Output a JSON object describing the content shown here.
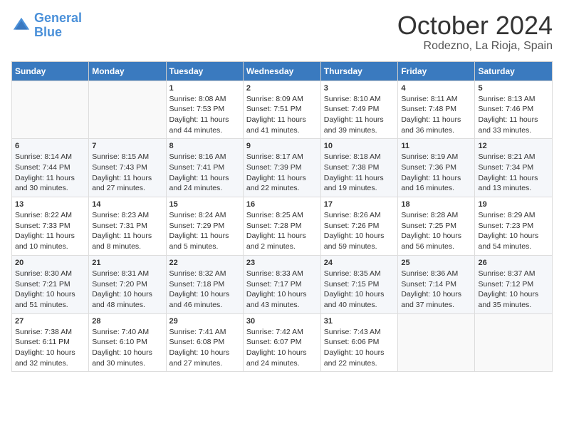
{
  "header": {
    "logo_line1": "General",
    "logo_line2": "Blue",
    "month": "October 2024",
    "location": "Rodezno, La Rioja, Spain"
  },
  "days_of_week": [
    "Sunday",
    "Monday",
    "Tuesday",
    "Wednesday",
    "Thursday",
    "Friday",
    "Saturday"
  ],
  "weeks": [
    [
      {
        "day": "",
        "content": ""
      },
      {
        "day": "",
        "content": ""
      },
      {
        "day": "1",
        "content": "Sunrise: 8:08 AM\nSunset: 7:53 PM\nDaylight: 11 hours and 44 minutes."
      },
      {
        "day": "2",
        "content": "Sunrise: 8:09 AM\nSunset: 7:51 PM\nDaylight: 11 hours and 41 minutes."
      },
      {
        "day": "3",
        "content": "Sunrise: 8:10 AM\nSunset: 7:49 PM\nDaylight: 11 hours and 39 minutes."
      },
      {
        "day": "4",
        "content": "Sunrise: 8:11 AM\nSunset: 7:48 PM\nDaylight: 11 hours and 36 minutes."
      },
      {
        "day": "5",
        "content": "Sunrise: 8:13 AM\nSunset: 7:46 PM\nDaylight: 11 hours and 33 minutes."
      }
    ],
    [
      {
        "day": "6",
        "content": "Sunrise: 8:14 AM\nSunset: 7:44 PM\nDaylight: 11 hours and 30 minutes."
      },
      {
        "day": "7",
        "content": "Sunrise: 8:15 AM\nSunset: 7:43 PM\nDaylight: 11 hours and 27 minutes."
      },
      {
        "day": "8",
        "content": "Sunrise: 8:16 AM\nSunset: 7:41 PM\nDaylight: 11 hours and 24 minutes."
      },
      {
        "day": "9",
        "content": "Sunrise: 8:17 AM\nSunset: 7:39 PM\nDaylight: 11 hours and 22 minutes."
      },
      {
        "day": "10",
        "content": "Sunrise: 8:18 AM\nSunset: 7:38 PM\nDaylight: 11 hours and 19 minutes."
      },
      {
        "day": "11",
        "content": "Sunrise: 8:19 AM\nSunset: 7:36 PM\nDaylight: 11 hours and 16 minutes."
      },
      {
        "day": "12",
        "content": "Sunrise: 8:21 AM\nSunset: 7:34 PM\nDaylight: 11 hours and 13 minutes."
      }
    ],
    [
      {
        "day": "13",
        "content": "Sunrise: 8:22 AM\nSunset: 7:33 PM\nDaylight: 11 hours and 10 minutes."
      },
      {
        "day": "14",
        "content": "Sunrise: 8:23 AM\nSunset: 7:31 PM\nDaylight: 11 hours and 8 minutes."
      },
      {
        "day": "15",
        "content": "Sunrise: 8:24 AM\nSunset: 7:29 PM\nDaylight: 11 hours and 5 minutes."
      },
      {
        "day": "16",
        "content": "Sunrise: 8:25 AM\nSunset: 7:28 PM\nDaylight: 11 hours and 2 minutes."
      },
      {
        "day": "17",
        "content": "Sunrise: 8:26 AM\nSunset: 7:26 PM\nDaylight: 10 hours and 59 minutes."
      },
      {
        "day": "18",
        "content": "Sunrise: 8:28 AM\nSunset: 7:25 PM\nDaylight: 10 hours and 56 minutes."
      },
      {
        "day": "19",
        "content": "Sunrise: 8:29 AM\nSunset: 7:23 PM\nDaylight: 10 hours and 54 minutes."
      }
    ],
    [
      {
        "day": "20",
        "content": "Sunrise: 8:30 AM\nSunset: 7:21 PM\nDaylight: 10 hours and 51 minutes."
      },
      {
        "day": "21",
        "content": "Sunrise: 8:31 AM\nSunset: 7:20 PM\nDaylight: 10 hours and 48 minutes."
      },
      {
        "day": "22",
        "content": "Sunrise: 8:32 AM\nSunset: 7:18 PM\nDaylight: 10 hours and 46 minutes."
      },
      {
        "day": "23",
        "content": "Sunrise: 8:33 AM\nSunset: 7:17 PM\nDaylight: 10 hours and 43 minutes."
      },
      {
        "day": "24",
        "content": "Sunrise: 8:35 AM\nSunset: 7:15 PM\nDaylight: 10 hours and 40 minutes."
      },
      {
        "day": "25",
        "content": "Sunrise: 8:36 AM\nSunset: 7:14 PM\nDaylight: 10 hours and 37 minutes."
      },
      {
        "day": "26",
        "content": "Sunrise: 8:37 AM\nSunset: 7:12 PM\nDaylight: 10 hours and 35 minutes."
      }
    ],
    [
      {
        "day": "27",
        "content": "Sunrise: 7:38 AM\nSunset: 6:11 PM\nDaylight: 10 hours and 32 minutes."
      },
      {
        "day": "28",
        "content": "Sunrise: 7:40 AM\nSunset: 6:10 PM\nDaylight: 10 hours and 30 minutes."
      },
      {
        "day": "29",
        "content": "Sunrise: 7:41 AM\nSunset: 6:08 PM\nDaylight: 10 hours and 27 minutes."
      },
      {
        "day": "30",
        "content": "Sunrise: 7:42 AM\nSunset: 6:07 PM\nDaylight: 10 hours and 24 minutes."
      },
      {
        "day": "31",
        "content": "Sunrise: 7:43 AM\nSunset: 6:06 PM\nDaylight: 10 hours and 22 minutes."
      },
      {
        "day": "",
        "content": ""
      },
      {
        "day": "",
        "content": ""
      }
    ]
  ]
}
